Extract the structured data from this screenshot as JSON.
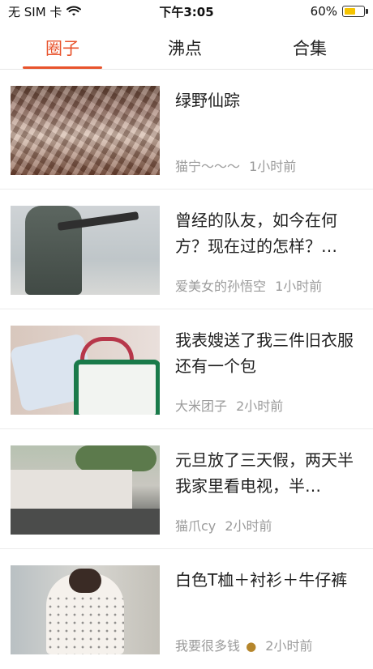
{
  "status_bar": {
    "carrier": "无 SIM 卡",
    "time": "下午3:05",
    "battery_percent_text": "60%",
    "battery_level": 0.6,
    "icons": [
      "wifi-icon",
      "battery-icon"
    ]
  },
  "tabs": [
    {
      "label": "圈子",
      "active": true
    },
    {
      "label": "沸点",
      "active": false
    },
    {
      "label": "合集",
      "active": false
    }
  ],
  "colors": {
    "accent": "#e8532c",
    "meta_text": "#9b9b9b",
    "divider": "#ececec"
  },
  "feed": [
    {
      "title": "绿野仙踪",
      "author": "猫宁～～～",
      "time": "1小时前"
    },
    {
      "title": "曾经的队友，如今在何方？现在过的怎样？…",
      "author": "爱美女的孙悟空",
      "time": "1小时前"
    },
    {
      "title": "我表嫂送了我三件旧衣服还有一个包",
      "author": "大米团子",
      "time": "2小时前"
    },
    {
      "title": "元旦放了三天假，两天半我家里看电视，半…",
      "author": "猫爪cy",
      "time": "2小时前"
    },
    {
      "title": "白色T桖＋衬衫＋牛仔裤",
      "author": "我要很多钱",
      "author_emoji": "money-bag-icon",
      "time": "2小时前"
    }
  ]
}
